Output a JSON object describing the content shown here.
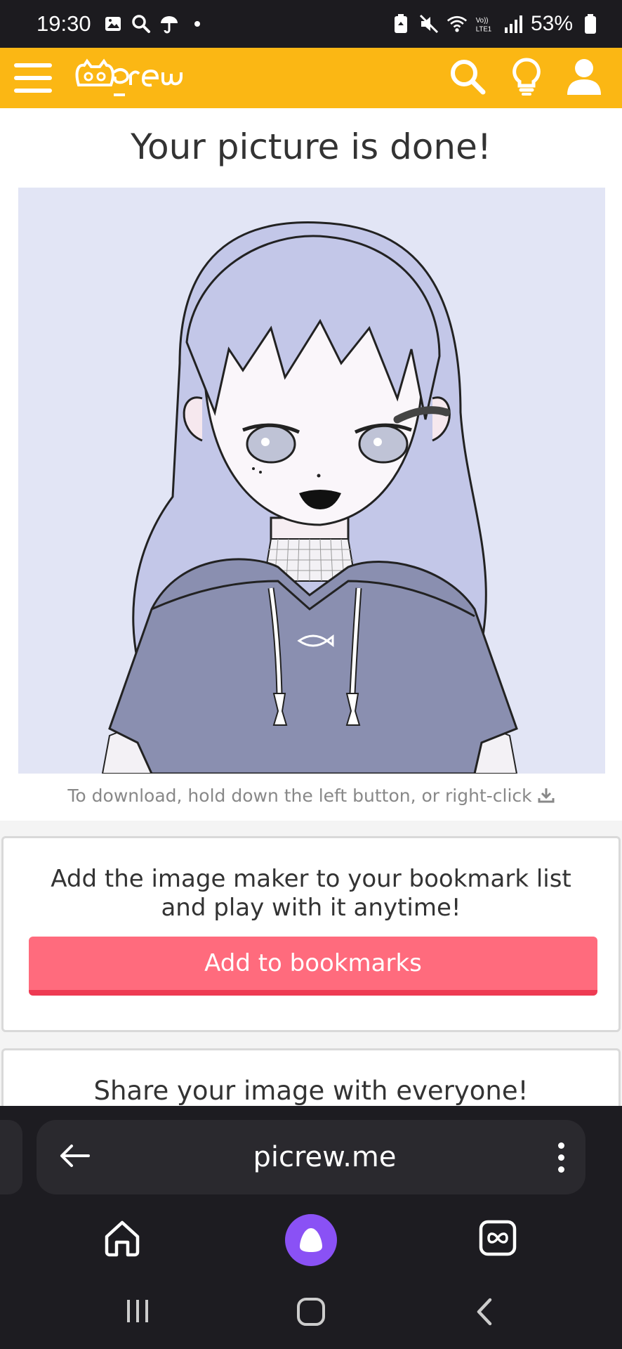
{
  "status_bar": {
    "time": "19:30",
    "battery": "53%"
  },
  "header": {
    "logo_text": "Picrew",
    "accent_color": "#fbb714"
  },
  "main": {
    "title": "Your picture is done!",
    "download_hint": "To download, hold down the left button, or right-click"
  },
  "bookmark_card": {
    "text_line1": "Add the image maker to your bookmark list",
    "text_line2": "and play with it anytime!",
    "button_label": "Add to bookmarks",
    "button_color": "#ff6b7d"
  },
  "share_card": {
    "text": "Share your image with everyone!"
  },
  "browser": {
    "url": "picrew.me"
  }
}
